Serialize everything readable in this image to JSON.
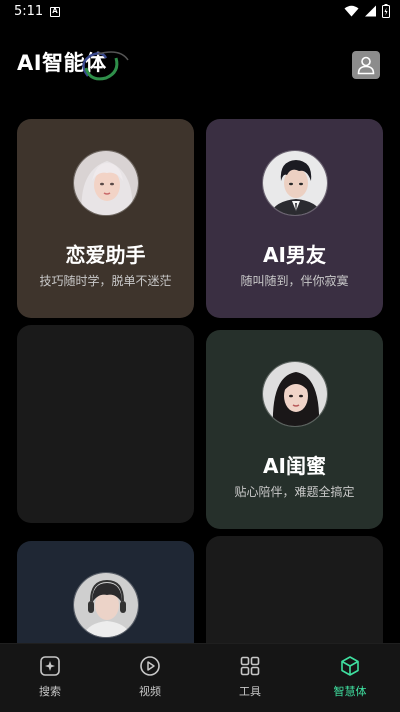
{
  "status_bar": {
    "time": "5:11",
    "notification_letter": "A"
  },
  "header": {
    "title": "AI智能体"
  },
  "cards": [
    {
      "title": "恋爱助手",
      "subtitle": "技巧随时学，脱单不迷茫",
      "avatar": "woman-with-silver-hair-avatar"
    },
    {
      "title": "AI男友",
      "subtitle": "随叫随到，伴你寂寞",
      "avatar": "man-in-suit-avatar"
    },
    {
      "title": "AI闺蜜",
      "subtitle": "贴心陪伴，难题全搞定",
      "avatar": "woman-with-dark-hair-avatar"
    }
  ],
  "bottom_nav": [
    {
      "label": "搜索",
      "icon": "sparkle-search-icon",
      "active": false
    },
    {
      "label": "视频",
      "icon": "play-icon",
      "active": false
    },
    {
      "label": "工具",
      "icon": "grid-icon",
      "active": false
    },
    {
      "label": "智慧体",
      "icon": "cube-icon",
      "active": true
    }
  ],
  "colors": {
    "background": "#000000",
    "card_love": "#3e342c",
    "card_boyfriend": "#3a2f42",
    "card_bestie": "#26302b",
    "card_empty": "#1a1a1a",
    "card_bottom_left": "#1f2734",
    "active_nav": "#3fe0a0"
  }
}
